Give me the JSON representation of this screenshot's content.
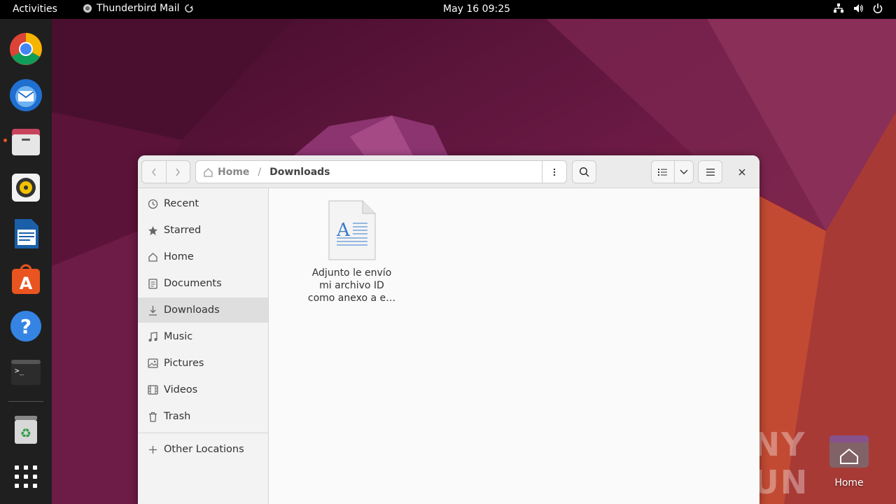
{
  "topbar": {
    "activities": "Activities",
    "app_name": "Thunderbird Mail",
    "clock": "May 16  09:25"
  },
  "dock": {
    "items": [
      "chrome-icon",
      "thunderbird-icon",
      "files-icon",
      "rhythmbox-icon",
      "writer-icon",
      "software-icon",
      "help-icon",
      "terminal-icon",
      "trash-icon",
      "app-grid-icon"
    ]
  },
  "window": {
    "path": {
      "home": "Home",
      "current": "Downloads"
    },
    "sidebar": {
      "items": [
        {
          "label": "Recent",
          "icon": "clock-icon"
        },
        {
          "label": "Starred",
          "icon": "star-icon"
        },
        {
          "label": "Home",
          "icon": "home-icon"
        },
        {
          "label": "Documents",
          "icon": "document-icon"
        },
        {
          "label": "Downloads",
          "icon": "download-icon"
        },
        {
          "label": "Music",
          "icon": "music-icon"
        },
        {
          "label": "Pictures",
          "icon": "picture-icon"
        },
        {
          "label": "Videos",
          "icon": "video-icon"
        },
        {
          "label": "Trash",
          "icon": "trash-icon"
        }
      ],
      "other_locations": "Other Locations"
    },
    "files": [
      {
        "label_line1": "Adjunto le envío",
        "label_line2": "mi archivo ID",
        "label_line3": "como anexo a e…",
        "icon": "text-document-icon"
      }
    ]
  },
  "desktop": {
    "home_label": "Home",
    "watermark": "ANY RUN"
  },
  "colors": {
    "topbar": "#000000",
    "dock": "#1f1f1f",
    "accent": "#e95420"
  }
}
